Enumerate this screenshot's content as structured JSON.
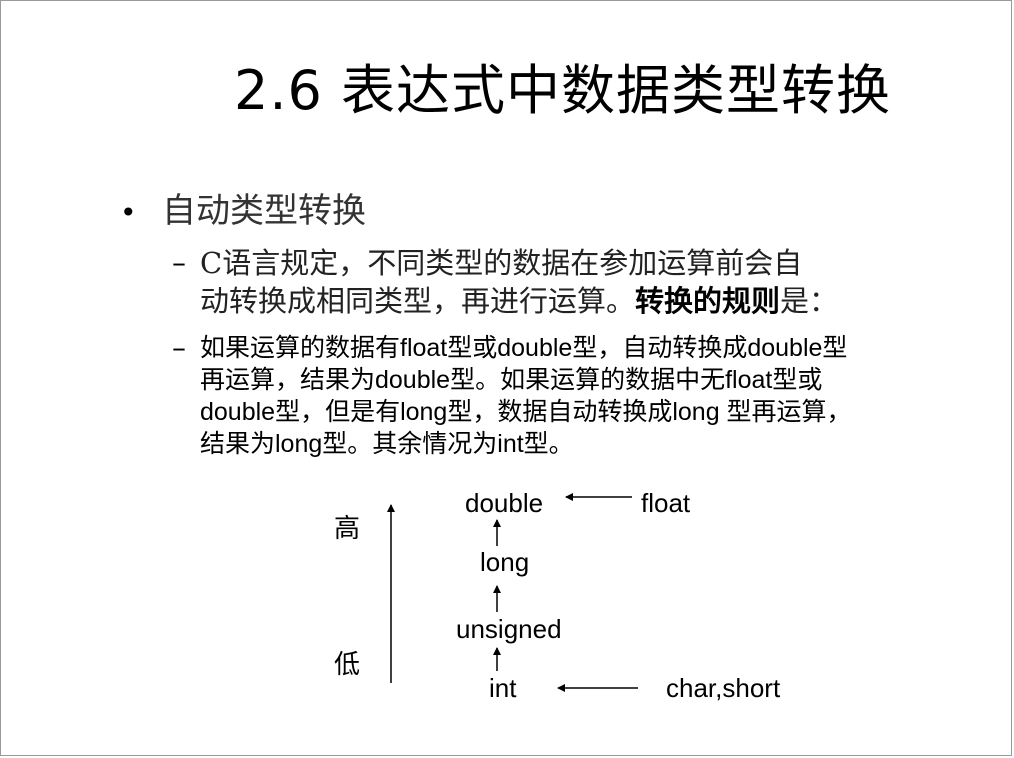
{
  "slide": {
    "title": "2.6 表达式中数据类型转换",
    "bullet": {
      "marker": "•",
      "text": "自动类型转换"
    },
    "sub_items": [
      {
        "dash": "–",
        "line1": "C语言规定，不同类型的数据在参加运算前会自",
        "line2_normal": "动转换成相同类型，再进行运算。",
        "line2_bold": "转换的规则",
        "line2_end": "是："
      },
      {
        "dash": "–",
        "lines": [
          "如果运算的数据有float型或double型，自动转换成double型",
          "再运算，结果为double型。如果运算的数据中无float型或",
          "double型，但是有long型，数据自动转换成long 型再运算，",
          "结果为long型。其余情况为int型。"
        ]
      }
    ]
  },
  "diagram": {
    "high_label": "高",
    "low_label": "低",
    "types": {
      "double": "double",
      "long": "long",
      "unsigned": "unsigned",
      "int": "int"
    },
    "sources": {
      "float": "float",
      "char_short": "char,short"
    }
  }
}
